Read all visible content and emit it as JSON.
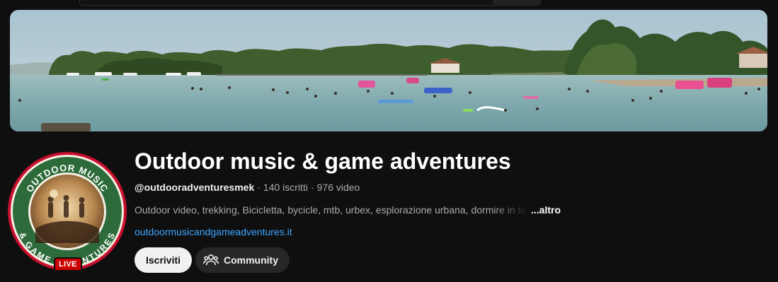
{
  "channel": {
    "title": "Outdoor music & game adventures",
    "handle": "@outdooradventuresmek",
    "subscribers": "140 iscritti",
    "videos": "976 video",
    "separator": "·",
    "description": "Outdoor video, trekking, Bicicletta, bycicle, mtb, urbex, esplorazione urbana, dormire in tenda",
    "more_label": "...altro",
    "website": "outdoormusicandgameadventures.it"
  },
  "avatar": {
    "top_text": "OUTDOOR MUSIC",
    "bottom_text": "& GAME ADVENTURES",
    "live_badge": "LIVE",
    "ring_color": "#2e6b3a",
    "border_color": "#c8102e"
  },
  "buttons": {
    "subscribe_label": "Iscriviti",
    "community_label": "Community",
    "community_icon": "people-icon"
  },
  "colors": {
    "background": "#0f0f0f",
    "link": "#3ea6ff",
    "live": "#cc0000"
  }
}
